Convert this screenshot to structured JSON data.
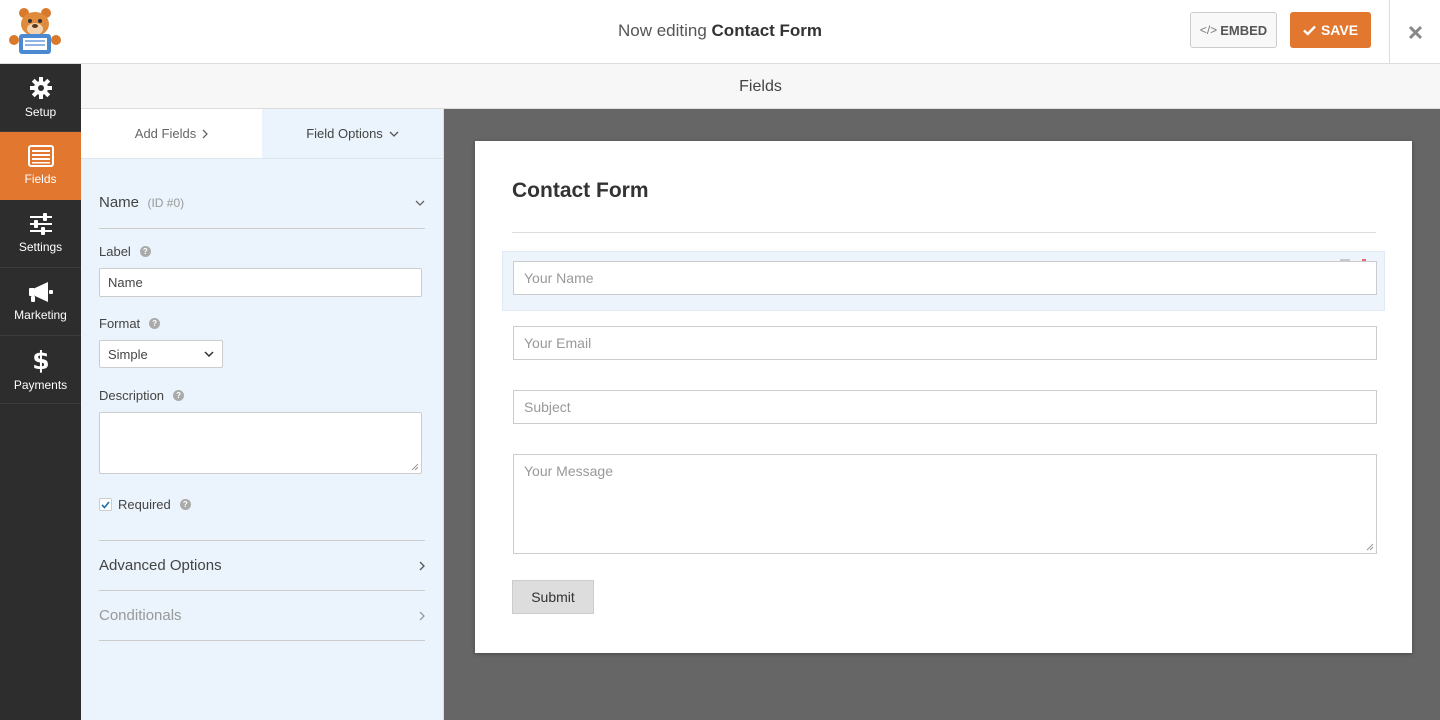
{
  "header": {
    "editing_prefix": "Now editing",
    "form_name": "Contact Form",
    "embed_label": "EMBED",
    "embed_code_icon": "</>",
    "save_label": "SAVE"
  },
  "nav": {
    "items": [
      {
        "label": "Setup",
        "icon": "gear-icon"
      },
      {
        "label": "Fields",
        "icon": "list-icon"
      },
      {
        "label": "Settings",
        "icon": "sliders-icon"
      },
      {
        "label": "Marketing",
        "icon": "megaphone-icon"
      },
      {
        "label": "Payments",
        "icon": "dollar-icon"
      }
    ]
  },
  "fields_header": "Fields",
  "panel": {
    "tab_add": "Add Fields",
    "tab_options": "Field Options",
    "field_name": "Name",
    "field_id": "(ID #0)",
    "label_label": "Label",
    "label_value": "Name",
    "format_label": "Format",
    "format_value": "Simple",
    "description_label": "Description",
    "required_label": "Required",
    "required_checked": true,
    "advanced_label": "Advanced Options",
    "conditionals_label": "Conditionals"
  },
  "form": {
    "title": "Contact Form",
    "fields": [
      {
        "placeholder": "Your Name"
      },
      {
        "placeholder": "Your Email"
      },
      {
        "placeholder": "Subject"
      },
      {
        "placeholder": "Your Message"
      }
    ],
    "submit_label": "Submit"
  },
  "colors": {
    "accent": "#e27730",
    "sidebar": "#2d2d2d",
    "panel_bg": "#ebf3fc",
    "canvas_bg": "#666666"
  }
}
